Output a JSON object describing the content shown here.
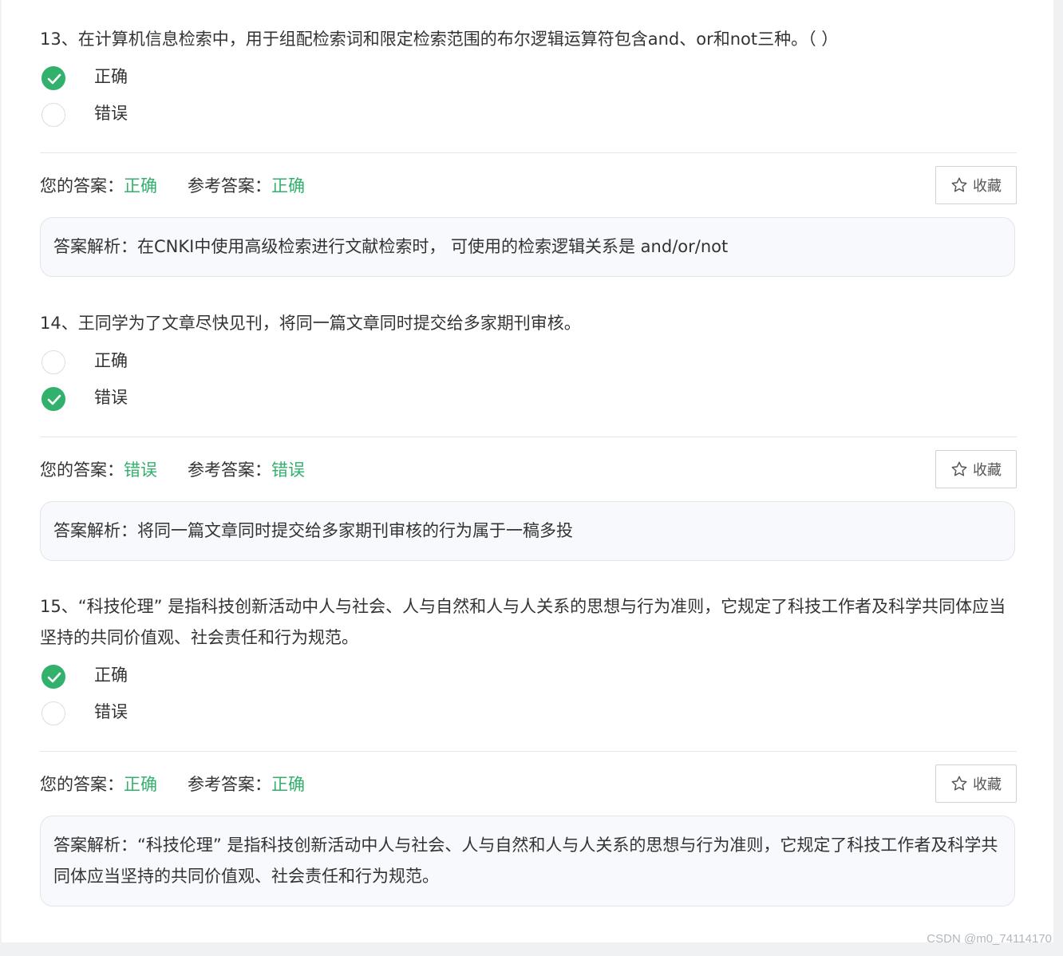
{
  "questions": [
    {
      "text": "13、在计算机信息检索中，用于组配检索词和限定检索范围的布尔逻辑运算符包含and、or和not三种。（ ）",
      "options": [
        {
          "label": "正确",
          "checked": true
        },
        {
          "label": "错误",
          "checked": false
        }
      ],
      "your_answer_label": "您的答案：",
      "your_answer": "正确",
      "ref_answer_label": "参考答案：",
      "ref_answer": "正确",
      "favorite_label": "收藏",
      "analysis": "答案解析：在CNKI中使用高级检索进行文献检索时， 可使用的检索逻辑关系是 and/or/not"
    },
    {
      "text": "14、王同学为了文章尽快见刊，将同一篇文章同时提交给多家期刊审核。",
      "options": [
        {
          "label": "正确",
          "checked": false
        },
        {
          "label": "错误",
          "checked": true
        }
      ],
      "your_answer_label": "您的答案：",
      "your_answer": "错误",
      "ref_answer_label": "参考答案：",
      "ref_answer": "错误",
      "favorite_label": "收藏",
      "analysis": "答案解析：将同一篇文章同时提交给多家期刊审核的行为属于一稿多投"
    },
    {
      "text": "15、“科技伦理” 是指科技创新活动中人与社会、人与自然和人与人关系的思想与行为准则，它规定了科技工作者及科学共同体应当坚持的共同价值观、社会责任和行为规范。",
      "options": [
        {
          "label": "正确",
          "checked": true
        },
        {
          "label": "错误",
          "checked": false
        }
      ],
      "your_answer_label": "您的答案：",
      "your_answer": "正确",
      "ref_answer_label": "参考答案：",
      "ref_answer": "正确",
      "favorite_label": "收藏",
      "analysis": "答案解析：“科技伦理” 是指科技创新活动中人与社会、人与自然和人与人关系的思想与行为准则，它规定了科技工作者及科学共同体应当坚持的共同价值观、社会责任和行为规范。"
    }
  ],
  "watermark": "CSDN @m0_74114170",
  "colors": {
    "accent": "#32b16c",
    "analysis_bg": "#f7f9fc",
    "border": "#e2e5ea"
  },
  "icons": {
    "check": "check-icon",
    "star": "star-icon"
  }
}
